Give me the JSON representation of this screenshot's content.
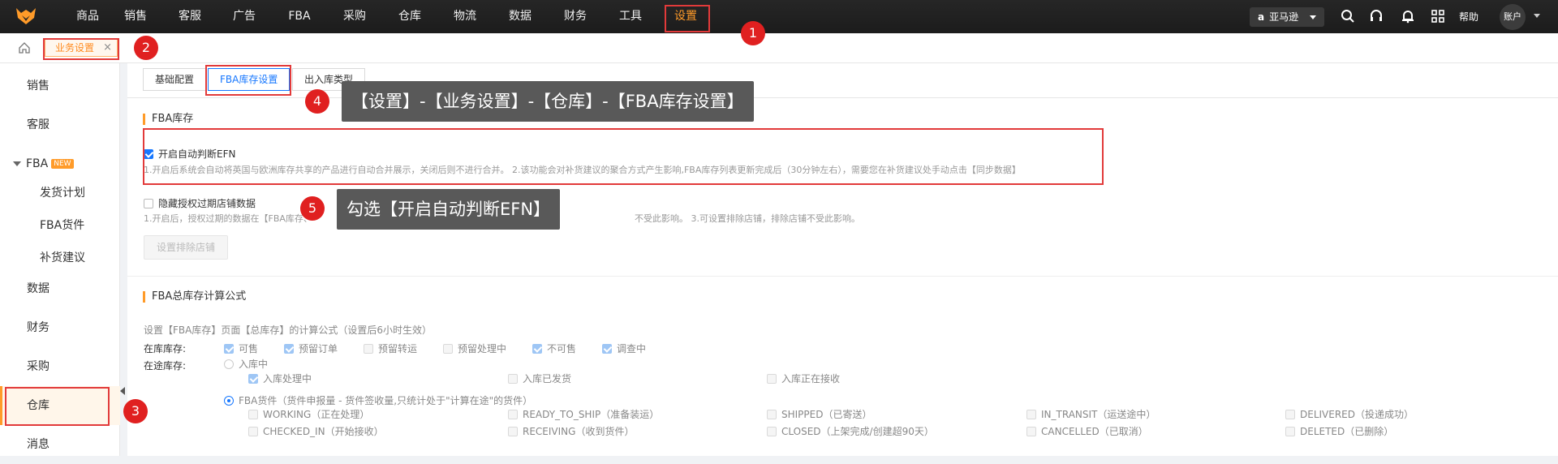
{
  "topnav": {
    "items": [
      "商品",
      "销售",
      "客服",
      "广告",
      "FBA",
      "采购",
      "仓库",
      "物流",
      "数据",
      "财务",
      "工具",
      "设置"
    ],
    "store": "亚马逊",
    "help": "帮助",
    "account": "账户"
  },
  "tabbar": {
    "active_tab": "业务设置",
    "close": "×"
  },
  "sidebar": {
    "items": [
      "销售",
      "客服",
      "FBA",
      "发货计划",
      "FBA货件",
      "补货建议",
      "数据",
      "财务",
      "采购",
      "仓库",
      "消息"
    ],
    "new_badge": "NEW"
  },
  "subtabs": [
    "基础配置",
    "FBA库存设置",
    "出入库类型"
  ],
  "fba_inventory": {
    "title": "FBA库存",
    "efn_label": "开启自动判断EFN",
    "efn_desc": "1.开启后系统会自动将英国与欧洲库存共享的产品进行自动合并展示，关闭后则不进行合并。 2.该功能会对补货建议的聚合方式产生影响,FBA库存列表更新完成后（30分钟左右），需要您在补货建议处手动点击【同步数据】",
    "hide_label": "隐藏授权过期店铺数据",
    "hide_desc_a": "1.开启后，授权过期的数据在【FBA库存、",
    "hide_desc_b": "不受此影响。 3.可设置排除店铺，排除店铺不受此影响。",
    "exclude_btn": "设置排除店铺"
  },
  "fba_total": {
    "title": "FBA总库存计算公式",
    "hint": "设置【FBA库存】页面【总库存】的计算公式（设置后6小时生效）",
    "in_stock_label": "在库库存:",
    "in_stock": [
      "可售",
      "预留订单",
      "预留转运",
      "预留处理中",
      "不可售",
      "调查中"
    ],
    "in_transit_label": "在途库存:",
    "inbound_radio": "入库中",
    "inbound_items": [
      "入库处理中",
      "入库已发货",
      "入库正在接收"
    ],
    "shipment_radio": "FBA货件（货件申报量 - 货件签收量,只统计处于\"计算在途\"的货件）",
    "shipment_row1": [
      "WORKING（正在处理）",
      "READY_TO_SHIP（准备装运）",
      "SHIPPED（已寄送）",
      "IN_TRANSIT（运送途中）",
      "DELIVERED（投递成功）"
    ],
    "shipment_row2": [
      "CHECKED_IN（开始接收）",
      "RECEIVING（收到货件）",
      "CLOSED（上架完成/创建超90天）",
      "CANCELLED（已取消）",
      "DELETED（已删除）"
    ]
  },
  "annotations": {
    "steps": [
      "1",
      "2",
      "3",
      "4",
      "5"
    ],
    "callout4": "【设置】-【业务设置】-【仓库】-【FBA库存设置】",
    "callout5": "勾选【开启自动判断EFN】",
    "red": "#e23a3a",
    "accent": "#ff9b29",
    "primary": "#1677ff"
  }
}
